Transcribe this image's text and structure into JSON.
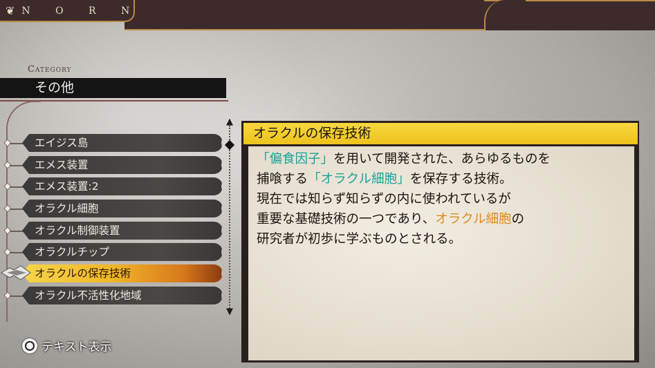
{
  "header": {
    "brand": "N O R N",
    "brand_icon": "fleur-icon"
  },
  "category": {
    "label": "Category",
    "value": "その他"
  },
  "list": {
    "items": [
      "エイジス島",
      "エメス装置",
      "エメス装置:2",
      "オラクル細胞",
      "オラクル制御装置",
      "オラクルチップ",
      "オラクルの保存技術",
      "オラクル不活性化地域"
    ],
    "selected_index": 6
  },
  "detail": {
    "title": "オラクルの保存技術",
    "line1_a": "「偏食因子」",
    "line1_b": "を用いて開発された、あらゆるものを",
    "line2_a": "捕喰する",
    "line2_b": "「オラクル細胞」",
    "line2_c": "を保存する技術。",
    "line3": "現在では知らず知らずの内に使われているが",
    "line4_a": "重要な基礎技術の一つであり、",
    "line4_b": "オラクル細胞",
    "line4_c": "の",
    "line5": "研究者が初歩に学ぶものとされる。"
  },
  "hint": {
    "button_icon": "circle-button-icon",
    "label": "テキスト表示"
  },
  "colors": {
    "topbar": "#3d2b2b",
    "gold_accent": "#b98a48",
    "title_yellow": "#f2c92a",
    "keyword_teal": "#1aa29a",
    "keyword_orange": "#dd8a1e"
  }
}
